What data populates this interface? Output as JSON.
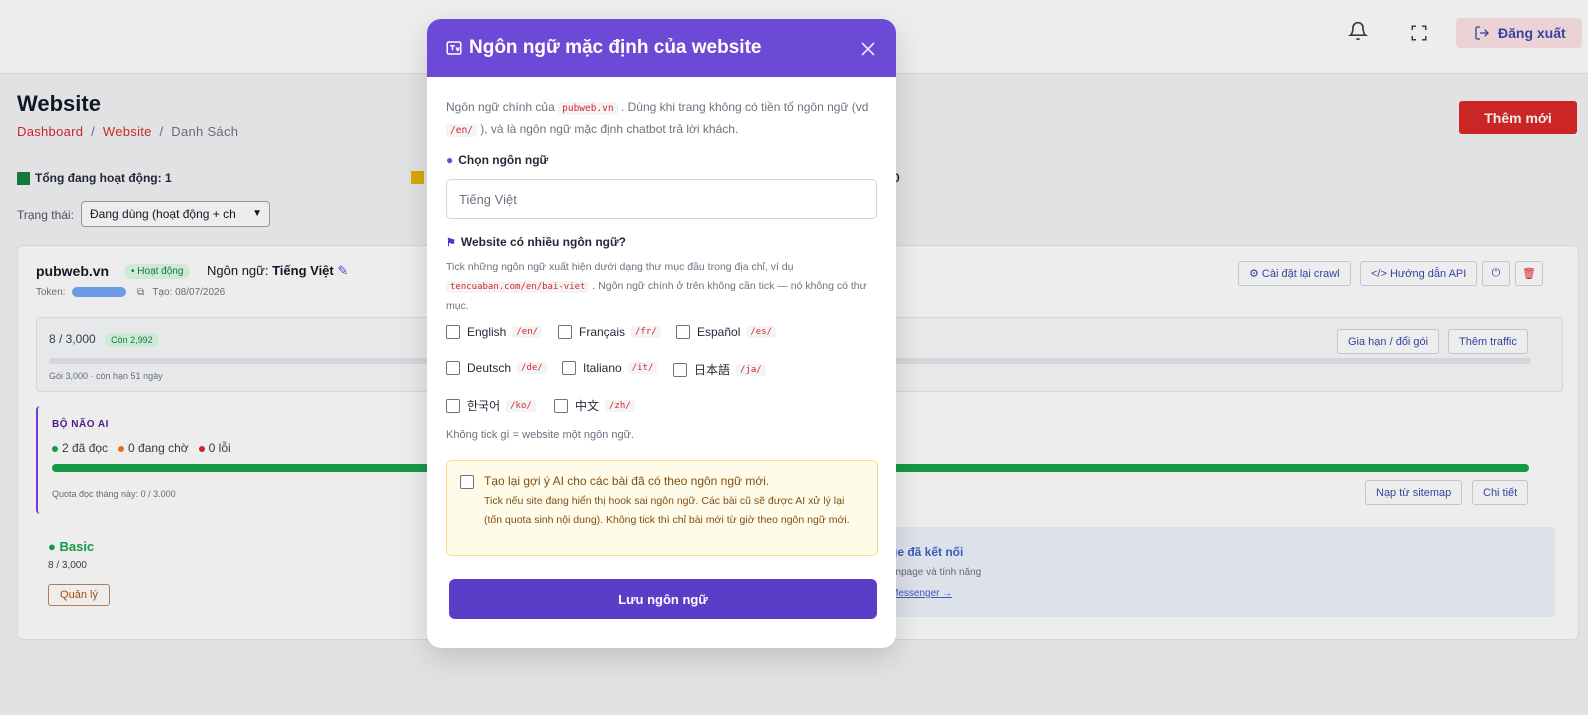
{
  "header": {
    "logout_label": "Đăng xuất",
    "bell_icon": "bell-icon",
    "fullscreen_icon": "expand-icon"
  },
  "page": {
    "title": "Website",
    "breadcrumb": [
      "Dashboard",
      "Website",
      "Danh Sách"
    ],
    "add_button": "Thêm mới",
    "stat_active": "Tổng đang hoạt động: 1",
    "stat_other_tail": "0",
    "filter_label": "Trạng thái:",
    "filter_value": "Đang dùng (hoạt động + ch"
  },
  "site": {
    "name": "pubweb.vn",
    "status": "• Hoạt động",
    "lang_prefix": "Ngôn ngữ:",
    "lang_value": "Tiếng Việt",
    "token_label": "Token:",
    "created": "Tạo: 08/07/2026",
    "buttons": [
      "⚙ Cài đặt lại crawl",
      "</> Hướng dẫn API"
    ],
    "quota_main": "8 / 3,000",
    "quota_left": "Còn 2,992",
    "quota_sub": "Gói 3,000 · còn hạn 51 ngày",
    "quota_buttons": [
      "Gia hạn / đổi gói",
      "Thêm traffic"
    ],
    "ai_title": "BỘ NÃO AI",
    "ai_read": "2 đã đọc",
    "ai_wait": "0 đang chờ",
    "ai_err": "0 lỗi",
    "ai_quota": "Quota đọc tháng này: 0 / 3.000",
    "ai_buttons": [
      "Nạp từ sitemap",
      "Chi tiết"
    ],
    "plan_name": "Basic",
    "plan_usage": "8 / 3,000",
    "plan_button": "Quản lý",
    "fb_title": "ge đã kết nối",
    "fb_sub": "anpage và tính năng",
    "fb_link": "Messenger →"
  },
  "modal": {
    "title": "Ngôn ngữ mặc định của website",
    "intro_a": "Ngôn ngữ chính của",
    "intro_domain": "pubweb.vn",
    "intro_b": ". Dùng khi trang không có tiền tố ngôn ngữ (vd",
    "intro_code": "/en/",
    "intro_c": "), và là ngôn ngữ mặc định chatbot trả lời khách.",
    "choose_label": "Chọn ngôn ngữ",
    "choose_value": "Tiếng Việt",
    "multi_label": "Website có nhiều ngôn ngữ?",
    "multi_desc_a": "Tick những ngôn ngữ xuất hiện dưới dạng thư mục đầu trong địa chỉ, ví dụ",
    "multi_desc_code": "tencuaban.com/en/bai-viet",
    "multi_desc_b": ". Ngôn ngữ chính ở trên không cần tick — nó không có thư mục.",
    "languages": [
      {
        "name": "English",
        "code": "/en/"
      },
      {
        "name": "Français",
        "code": "/fr/"
      },
      {
        "name": "Español",
        "code": "/es/"
      },
      {
        "name": "Deutsch",
        "code": "/de/"
      },
      {
        "name": "Italiano",
        "code": "/it/"
      },
      {
        "name": "日本語",
        "code": "/ja/"
      },
      {
        "name": "한국어",
        "code": "/ko/"
      },
      {
        "name": "中文",
        "code": "/zh/"
      }
    ],
    "note": "Không tick gì = website một ngôn ngữ.",
    "regen_title": "Tạo lại gợi ý AI cho các bài đã có theo ngôn ngữ mới.",
    "regen_desc": "Tick nếu site đang hiển thị hook sai ngôn ngữ. Các bài cũ sẽ được AI xử lý lại (tốn quota sinh nội dung). Không tick thì chỉ bài mới từ giờ theo ngôn ngữ mới.",
    "save_label": "Lưu ngôn ngữ"
  },
  "colors": {
    "modal_header": "#6d4ad6",
    "save_button": "#5b3ec8",
    "danger": "#dc2626",
    "success": "#16a34a"
  }
}
